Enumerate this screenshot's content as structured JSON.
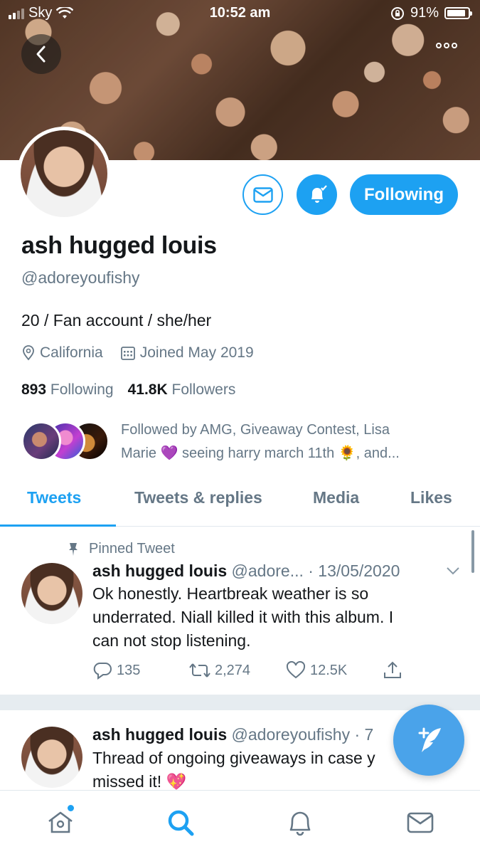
{
  "status_bar": {
    "carrier": "Sky",
    "time": "10:52 am",
    "battery": "91%"
  },
  "profile": {
    "name": "ash hugged louis",
    "handle": "@adoreyoufishy",
    "bio": "20 / Fan account / she/her",
    "location": "California",
    "joined": "Joined May 2019",
    "following_count": "893",
    "following_label": "Following",
    "followers_count": "41.8K",
    "followers_label": "Followers",
    "followed_by_line1": "Followed by AMG, Giveaway Contest, Lisa",
    "followed_by_line2": "Marie 💜 seeing harry march 11th 🌻, and..."
  },
  "buttons": {
    "following": "Following"
  },
  "tabs": [
    "Tweets",
    "Tweets & replies",
    "Media",
    "Likes"
  ],
  "tweets": [
    {
      "pinned_label": "Pinned Tweet",
      "author": "ash hugged louis",
      "handle": "@adore...",
      "date": "· 13/05/2020",
      "text_lines": [
        "Ok honestly. Heartbreak weather is so",
        "underrated. Niall killed it with this album. I",
        "can not stop listening."
      ],
      "replies": "135",
      "retweets": "2,274",
      "likes": "12.5K"
    },
    {
      "author": "ash hugged louis",
      "handle": "@adoreyoufishy",
      "date": "· 7",
      "text_lines": [
        "Thread of ongoing giveaways in case y",
        "missed it! 💖"
      ]
    }
  ],
  "colors": {
    "accent": "#1da1f2",
    "muted": "#657786"
  },
  "icons": [
    "back-icon",
    "more-icon",
    "mail-icon",
    "bell-icon",
    "location-icon",
    "calendar-icon",
    "pin-icon",
    "reply-icon",
    "retweet-icon",
    "like-icon",
    "share-icon",
    "compose-icon",
    "home-icon",
    "search-icon",
    "notifications-icon",
    "messages-icon"
  ]
}
